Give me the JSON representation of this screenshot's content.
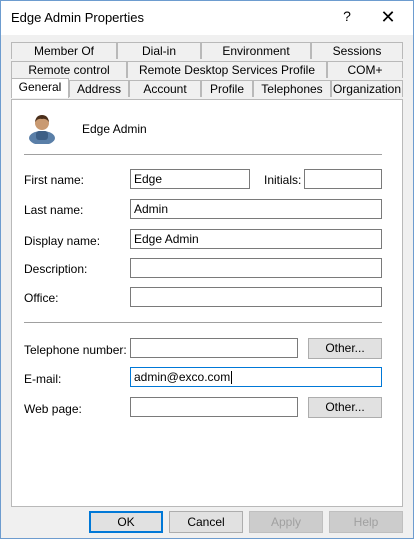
{
  "window": {
    "title": "Edge Admin Properties",
    "help_glyph": "?",
    "close_glyph": "✕"
  },
  "tabs": {
    "row1": [
      "Member Of",
      "Dial-in",
      "Environment",
      "Sessions"
    ],
    "row2": [
      "Remote control",
      "Remote Desktop Services Profile",
      "COM+"
    ],
    "row3": [
      "General",
      "Address",
      "Account",
      "Profile",
      "Telephones",
      "Organization"
    ],
    "selected": "General"
  },
  "general": {
    "user_name": "Edge Admin",
    "first_name_label": "First name:",
    "first_name_value": "Edge",
    "initials_label": "Initials:",
    "initials_value": "",
    "last_name_label": "Last name:",
    "last_name_value": "Admin",
    "display_name_label": "Display name:",
    "display_name_value": "Edge Admin",
    "description_label": "Description:",
    "description_value": "",
    "office_label": "Office:",
    "office_value": "",
    "telephone_label": "Telephone number:",
    "telephone_value": "",
    "telephone_other": "Other...",
    "email_label": "E-mail:",
    "email_value": "admin@exco.com",
    "webpage_label": "Web page:",
    "webpage_value": "",
    "webpage_other": "Other..."
  },
  "buttons": {
    "ok": "OK",
    "cancel": "Cancel",
    "apply": "Apply",
    "help": "Help"
  },
  "colors": {
    "focus_border": "#0078d7",
    "window_border": "#6d9ccf"
  }
}
